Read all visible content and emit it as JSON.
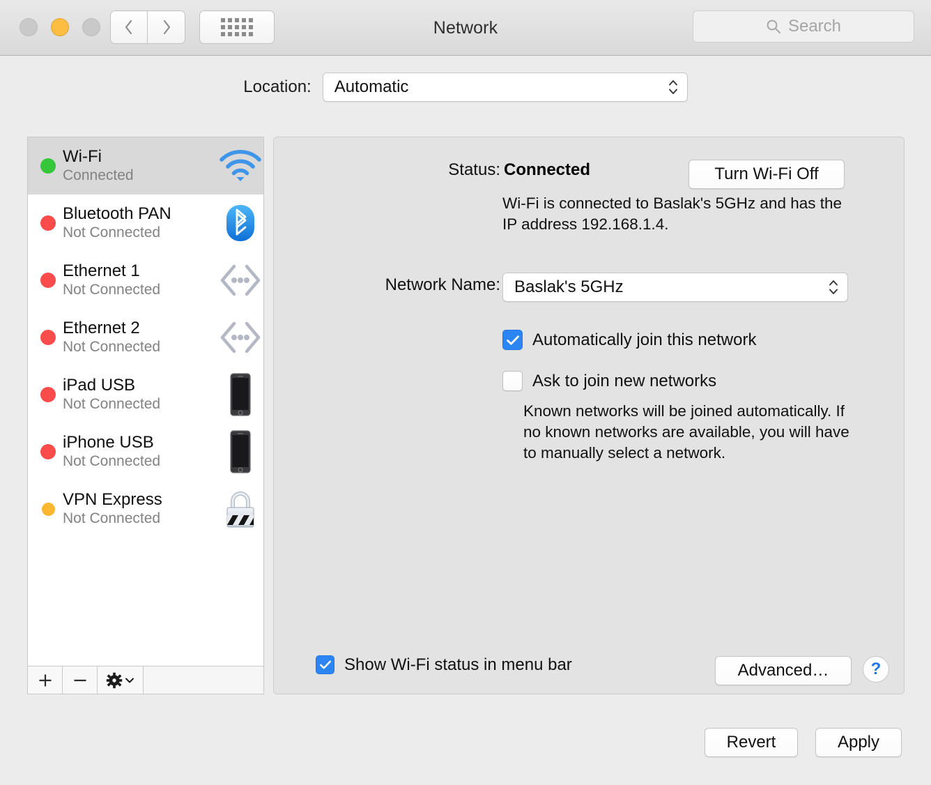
{
  "window": {
    "title": "Network",
    "traffic_lights": [
      "close",
      "minimize",
      "zoom"
    ],
    "back_label": "Back",
    "forward_label": "Forward",
    "show_all_label": "Show All"
  },
  "search": {
    "placeholder": "Search",
    "value": ""
  },
  "location": {
    "label": "Location:",
    "value": "Automatic",
    "options": [
      "Automatic"
    ]
  },
  "services": [
    {
      "name": "Wi-Fi",
      "status": "Connected",
      "dot": "green",
      "icon": "wifi-icon",
      "selected": true
    },
    {
      "name": "Bluetooth PAN",
      "status": "Not Connected",
      "dot": "red",
      "icon": "bluetooth-icon",
      "selected": false
    },
    {
      "name": "Ethernet 1",
      "status": "Not Connected",
      "dot": "red",
      "icon": "ethernet-icon",
      "selected": false
    },
    {
      "name": "Ethernet 2",
      "status": "Not Connected",
      "dot": "red",
      "icon": "ethernet-icon",
      "selected": false
    },
    {
      "name": "iPad USB",
      "status": "Not Connected",
      "dot": "red",
      "icon": "ipad-icon",
      "selected": false
    },
    {
      "name": "iPhone USB",
      "status": "Not Connected",
      "dot": "red",
      "icon": "iphone-icon",
      "selected": false
    },
    {
      "name": "VPN Express",
      "status": "Not Connected",
      "dot": "amber",
      "icon": "padlock-icon",
      "selected": false
    }
  ],
  "service_toolbar": {
    "add_label": "+",
    "remove_label": "−",
    "action_label": "Action menu"
  },
  "detail": {
    "status_label": "Status:",
    "status_value": "Connected",
    "turn_off_label": "Turn Wi-Fi Off",
    "status_description": "Wi-Fi is connected to Baslak's 5GHz and has the IP address 192.168.1.4.",
    "network_name_label": "Network Name:",
    "network_name_value": "Baslak's 5GHz",
    "auto_join_label": "Automatically join this network",
    "auto_join_checked": true,
    "ask_join_label": "Ask to join new networks",
    "ask_join_checked": false,
    "ask_join_subtext": "Known networks will be joined automatically. If no known networks are available, you will have to manually select a network.",
    "menu_bar_label": "Show Wi-Fi status in menu bar",
    "menu_bar_checked": true,
    "advanced_label": "Advanced…",
    "help_label": "?"
  },
  "footer": {
    "revert_label": "Revert",
    "apply_label": "Apply"
  },
  "colors": {
    "connected_dot": "#35c63a",
    "disconnected_dot": "#fb4b4b",
    "pending_dot": "#fcb731",
    "accent_blue": "#2b86f4",
    "help_blue": "#1e73e8"
  }
}
